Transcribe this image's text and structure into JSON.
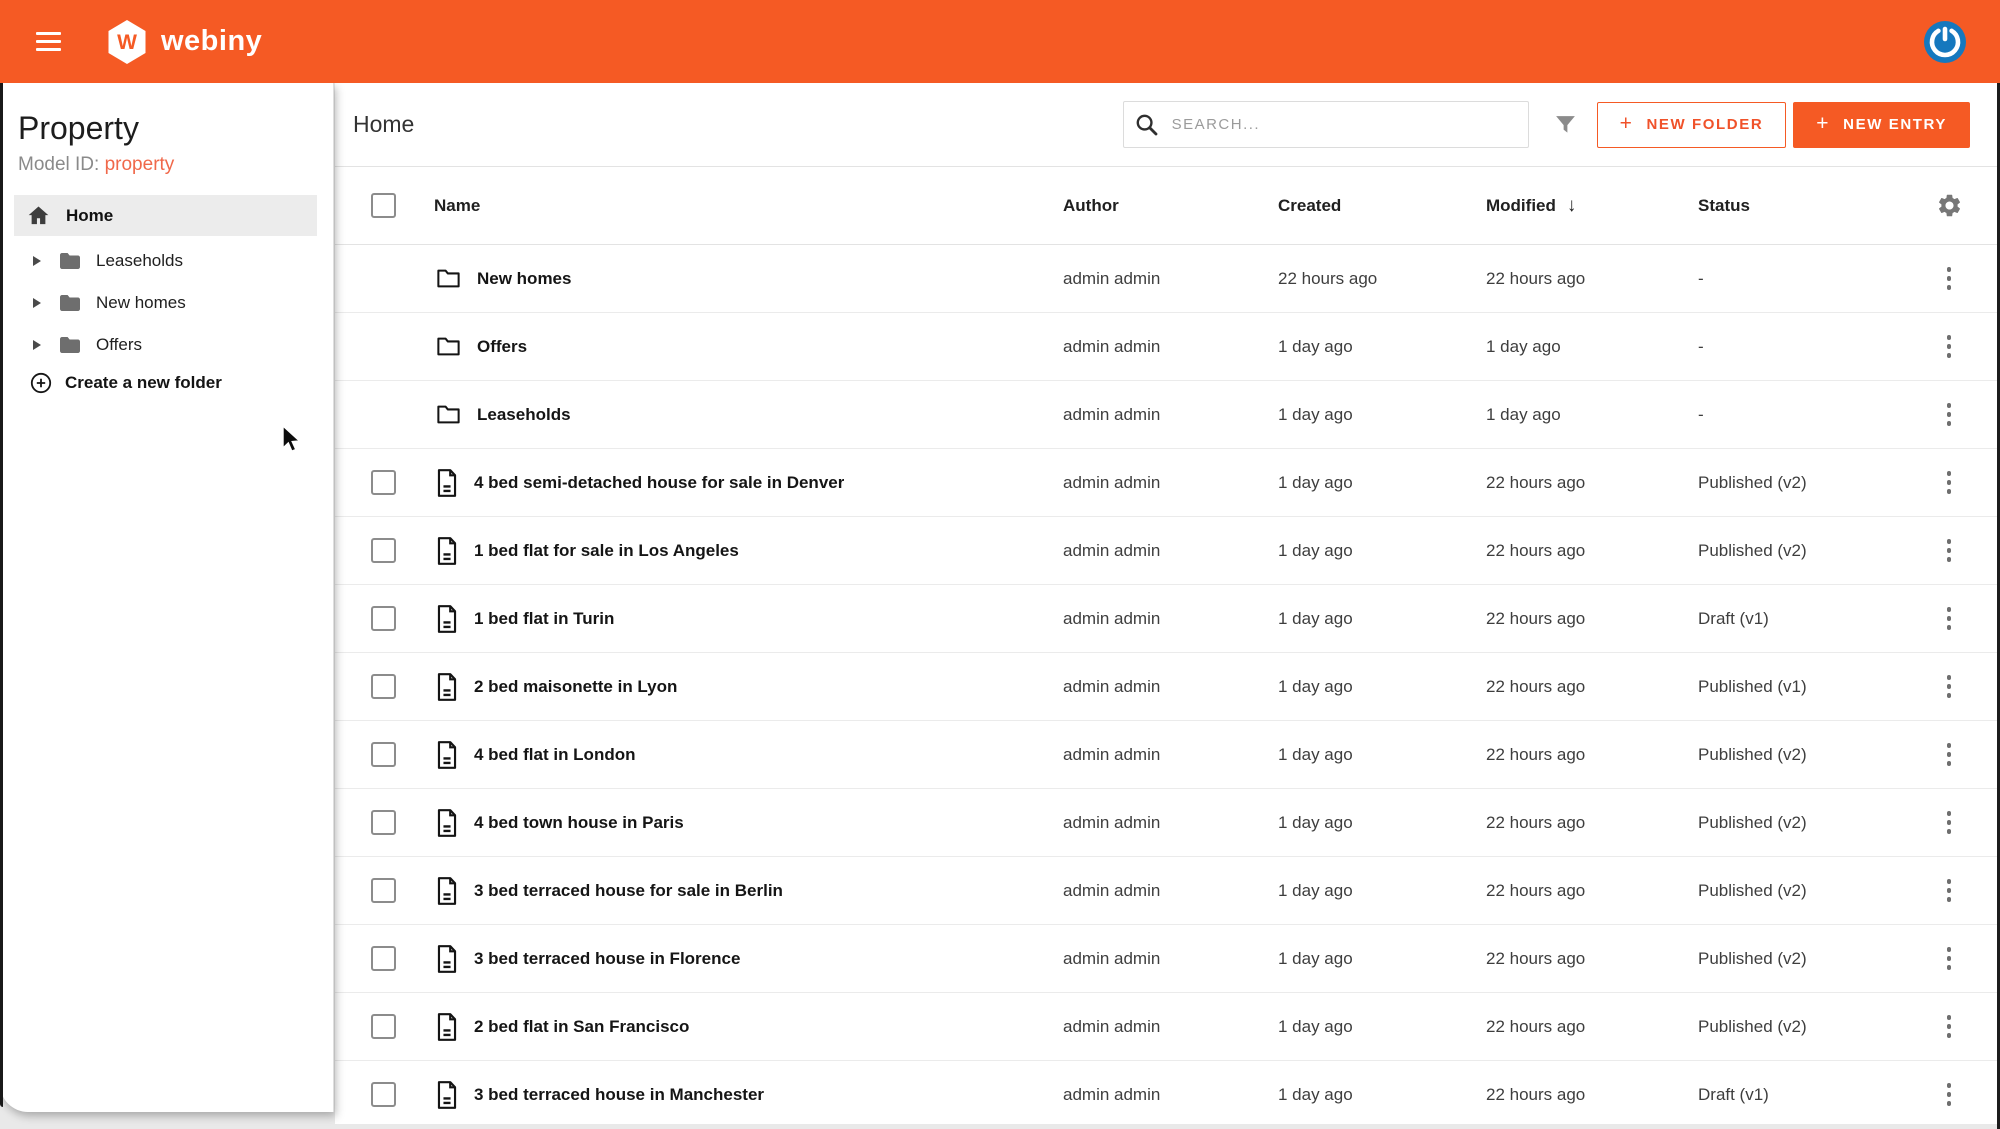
{
  "topbar": {
    "brand": "webiny",
    "brand_letter": "W"
  },
  "sidebar": {
    "title": "Property",
    "model_id_label": "Model ID: ",
    "model_id_value": "property",
    "home_label": "Home",
    "folders": [
      "Leaseholds",
      "New homes",
      "Offers"
    ],
    "create_folder_label": "Create a new folder"
  },
  "toolbar": {
    "title": "Home",
    "search_placeholder": "SEARCH...",
    "plus": "+",
    "new_folder_label": "NEW FOLDER",
    "new_entry_label": "NEW ENTRY"
  },
  "table": {
    "columns": [
      "Name",
      "Author",
      "Created",
      "Modified",
      "Status"
    ],
    "sort_column": "Modified",
    "sort_direction": "desc",
    "sort_indicator": "↓",
    "rows": [
      {
        "type": "folder",
        "name": "New homes",
        "author": "admin admin",
        "created": "22 hours ago",
        "modified": "22 hours ago",
        "status": "-"
      },
      {
        "type": "folder",
        "name": "Offers",
        "author": "admin admin",
        "created": "1 day ago",
        "modified": "1 day ago",
        "status": "-"
      },
      {
        "type": "folder",
        "name": "Leaseholds",
        "author": "admin admin",
        "created": "1 day ago",
        "modified": "1 day ago",
        "status": "-"
      },
      {
        "type": "entry",
        "name": "4 bed semi-detached house for sale in Denver",
        "author": "admin admin",
        "created": "1 day ago",
        "modified": "22 hours ago",
        "status": "Published (v2)"
      },
      {
        "type": "entry",
        "name": "1 bed flat for sale in Los Angeles",
        "author": "admin admin",
        "created": "1 day ago",
        "modified": "22 hours ago",
        "status": "Published (v2)"
      },
      {
        "type": "entry",
        "name": "1 bed flat in Turin",
        "author": "admin admin",
        "created": "1 day ago",
        "modified": "22 hours ago",
        "status": "Draft (v1)"
      },
      {
        "type": "entry",
        "name": "2 bed maisonette in Lyon",
        "author": "admin admin",
        "created": "1 day ago",
        "modified": "22 hours ago",
        "status": "Published (v1)"
      },
      {
        "type": "entry",
        "name": "4 bed flat in London",
        "author": "admin admin",
        "created": "1 day ago",
        "modified": "22 hours ago",
        "status": "Published (v2)"
      },
      {
        "type": "entry",
        "name": "4 bed town house in Paris",
        "author": "admin admin",
        "created": "1 day ago",
        "modified": "22 hours ago",
        "status": "Published (v2)"
      },
      {
        "type": "entry",
        "name": "3 bed terraced house for sale in Berlin",
        "author": "admin admin",
        "created": "1 day ago",
        "modified": "22 hours ago",
        "status": "Published (v2)"
      },
      {
        "type": "entry",
        "name": "3 bed terraced house in Florence",
        "author": "admin admin",
        "created": "1 day ago",
        "modified": "22 hours ago",
        "status": "Published (v2)"
      },
      {
        "type": "entry",
        "name": "2 bed flat in San Francisco",
        "author": "admin admin",
        "created": "1 day ago",
        "modified": "22 hours ago",
        "status": "Published (v2)"
      },
      {
        "type": "entry",
        "name": "3 bed terraced house in Manchester",
        "author": "admin admin",
        "created": "1 day ago",
        "modified": "22 hours ago",
        "status": "Draft (v1)"
      }
    ]
  },
  "icons": {
    "menu": "hamburger",
    "user": "gravatar-power",
    "search": "magnifier",
    "filter": "funnel",
    "settings": "gear",
    "row_menu": "kebab-vertical",
    "sort": "arrow-down",
    "home": "house",
    "folder": "folder",
    "entry": "document",
    "create": "plus-circle"
  },
  "colors": {
    "accent": "#f55a24",
    "model_id_orange": "#f0684a",
    "avatar_blue": "#1578be",
    "selected_bg": "#ececec"
  }
}
